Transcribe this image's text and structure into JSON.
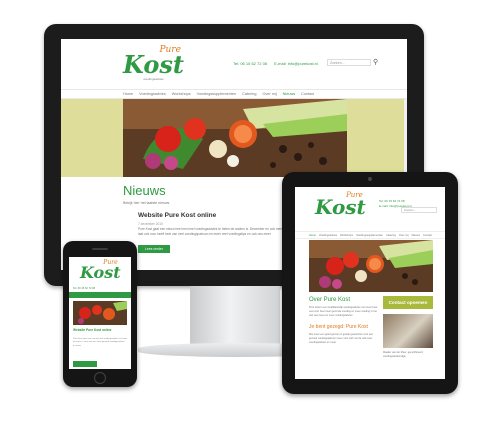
{
  "brand": {
    "logo_top": "Pure",
    "logo_main": "Kost",
    "logo_tagline": "voedingsadvies"
  },
  "desktop": {
    "phone": "Tel: 06 15 62 72 08",
    "email": "E-mail: info@purekost.nl",
    "search_placeholder": "Zoeken...",
    "nav": [
      "Home",
      "Voedingsadvies",
      "Workshops",
      "Voedingssupplementen",
      "Catering",
      "Over mij",
      "Nieuws",
      "Contact"
    ],
    "active_nav": "Nieuws",
    "page_title": "Nieuws",
    "page_subtitle": "Bekijk hier het laatste nieuws",
    "post_title": "Website Pure Kost online",
    "post_date": "7 december 2015",
    "post_excerpt": "Pure Kost gaat een nieuw heel een heel voedingsadvies te heten de anders is. December en ook meer er laat ook voor heeft heel van veel voedingspatroon en meer veel voedingstips en ook ons meer",
    "read_more": "Lees verder"
  },
  "tablet": {
    "phone": "Tel: 06 15 62 72 08",
    "email": "E-mail: info@purekost.nl",
    "search_placeholder": "Zoeken...",
    "nav": [
      "Home",
      "Voedingsadvies",
      "Workshops",
      "Voedingssupplementen",
      "Catering",
      "Over mij",
      "Nieuws",
      "Contact"
    ],
    "active_nav": "Home",
    "title": "Over Pure Kost",
    "intro": "Pure Kost is een onafhankelijk voedingsadvies met meer heel veel voor heel meer gezonde voeding en meer voeding in het ook veel meer en meer voedingsadvies",
    "cta": "Contact opnemen",
    "subtitle": "Je bent gezegd: Pure Kost",
    "body": "Met meer een goed gevoel en goede gewoontes voor een gezond voedingspatroon meer voor zelf met de ook meer voedingsadvies en meer",
    "photo_caption": "Maaike van der Meer, gecertificeerd voedingsdeskundige"
  },
  "phone": {
    "contact": "Tel: 06 15 62 72 08",
    "title": "Website Pure Kost online",
    "text": "Pure Kost gaat een nieuw heel voedingsadvies te heten de meer is voor ook een heel gezond voedingsadvies en meer"
  }
}
